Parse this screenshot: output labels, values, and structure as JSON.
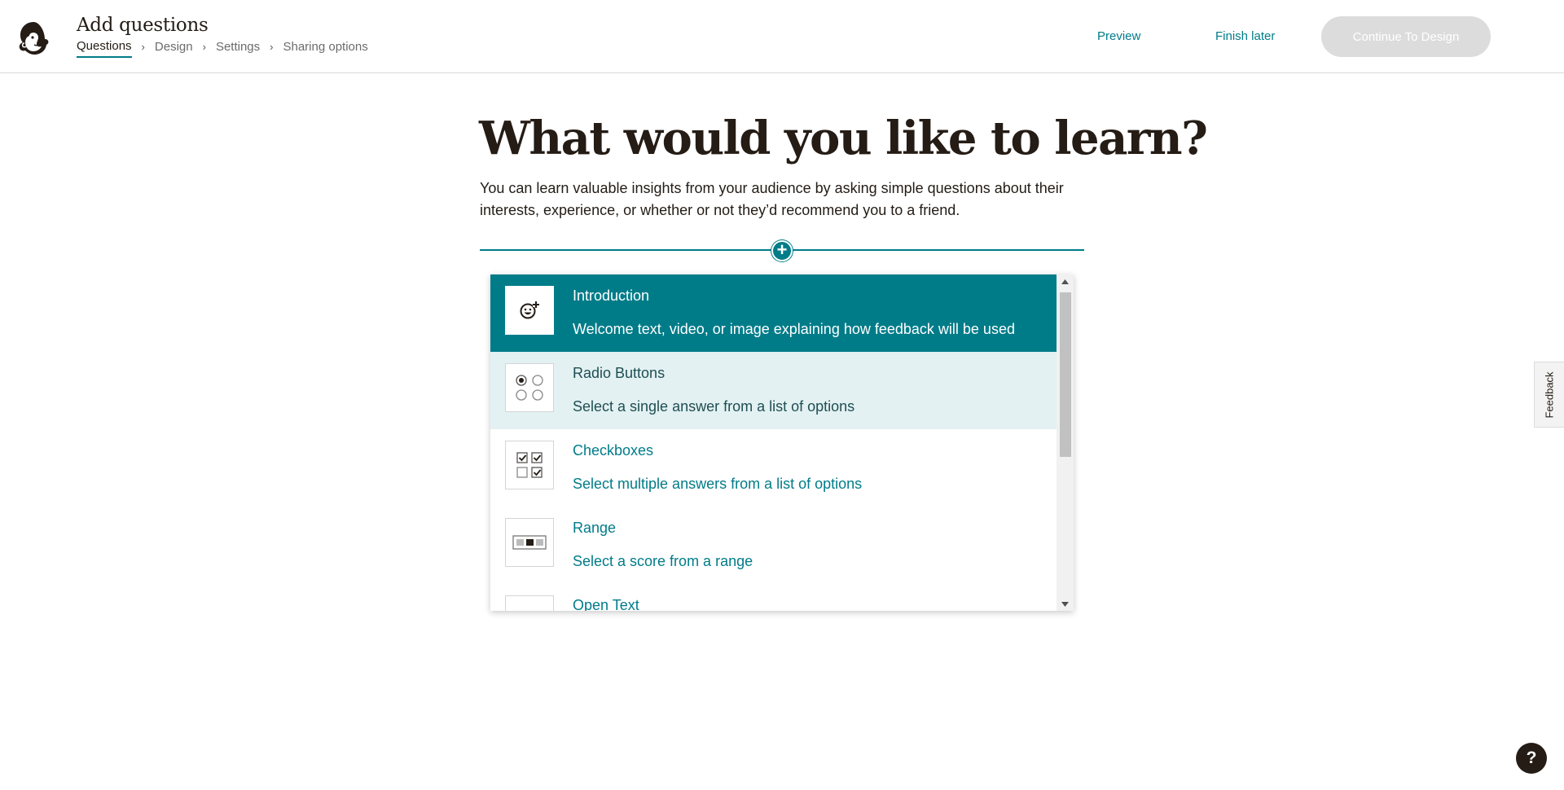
{
  "header": {
    "title": "Add questions",
    "breadcrumb": [
      {
        "label": "Questions",
        "active": true
      },
      {
        "label": "Design",
        "active": false
      },
      {
        "label": "Settings",
        "active": false
      },
      {
        "label": "Sharing options",
        "active": false
      }
    ],
    "preview_label": "Preview",
    "finish_later_label": "Finish later",
    "continue_label": "Continue To Design"
  },
  "main": {
    "heading": "What would you like to learn?",
    "intro": "You can learn valuable insights from your audience by asking simple questions about their interests, experience, or whether or not they’d recommend you to a friend.",
    "add_icon": "plus-icon"
  },
  "question_types": [
    {
      "title": "Introduction",
      "description": "Welcome text, video, or image explaining how feedback will be used",
      "icon": "smiley-plus-icon",
      "state": "selected"
    },
    {
      "title": "Radio Buttons",
      "description": "Select a single answer from a list of options",
      "icon": "radio-buttons-icon",
      "state": "hover"
    },
    {
      "title": "Checkboxes",
      "description": "Select multiple answers from a list of options",
      "icon": "checkboxes-icon",
      "state": "normal"
    },
    {
      "title": "Range",
      "description": "Select a score from a range",
      "icon": "range-icon",
      "state": "normal"
    },
    {
      "title": "Open Text",
      "description": "",
      "icon": "open-text-icon",
      "state": "normal"
    }
  ],
  "feedback_label": "Feedback",
  "help_label": "?",
  "colors": {
    "accent": "#007c89",
    "hover_bg": "#e3f1f2",
    "disabled_button": "#dcdcdc",
    "text": "#241c15"
  }
}
